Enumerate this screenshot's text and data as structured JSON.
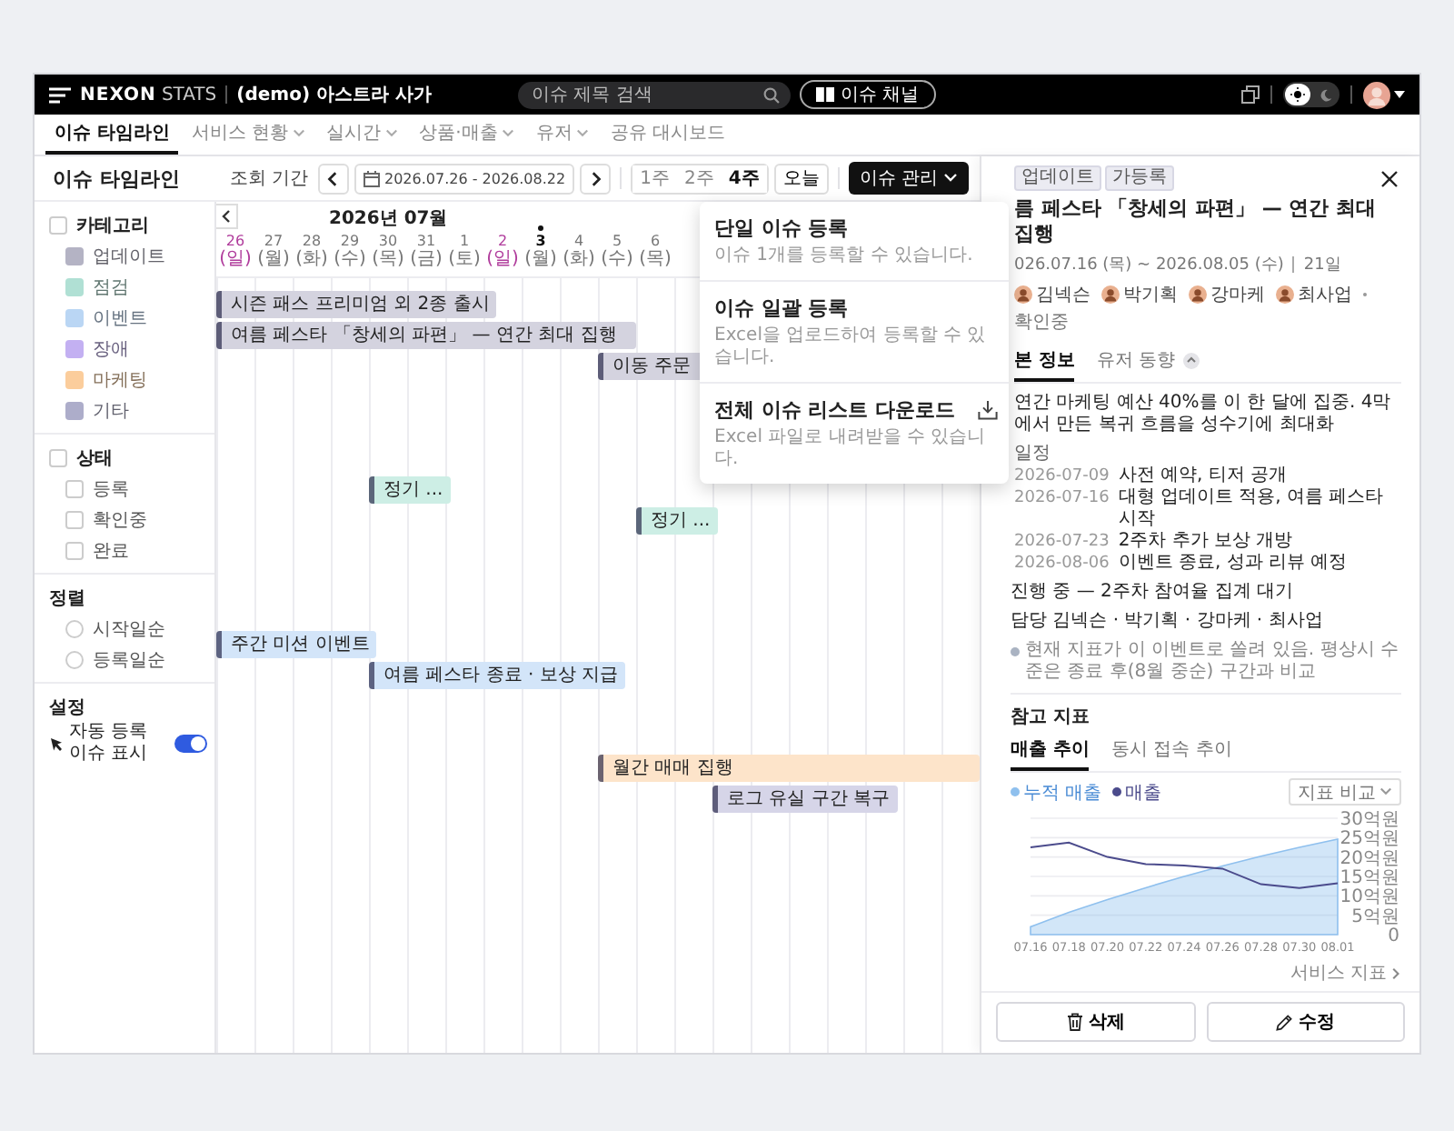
{
  "topbar": {
    "logo_bold": "NEXON",
    "logo_light": "STATS",
    "workspace": "(demo) 아스트라 사가",
    "search": {
      "placeholder": "이슈 제목 검색"
    },
    "channel_button": "이슈 채널",
    "theme": [
      {
        "kind": "light",
        "selected": true
      },
      {
        "kind": "dark",
        "selected": false
      }
    ]
  },
  "nav": [
    {
      "label": "이슈 타임라인",
      "selected": true,
      "dropdown": false
    },
    {
      "label": "서비스 현황",
      "selected": false,
      "dropdown": true
    },
    {
      "label": "실시간",
      "selected": false,
      "dropdown": true
    },
    {
      "label": "상품·매출",
      "selected": false,
      "dropdown": true
    },
    {
      "label": "유저",
      "selected": false,
      "dropdown": true
    },
    {
      "label": "공유 대시보드",
      "selected": false,
      "dropdown": false
    }
  ],
  "header": {
    "title": "이슈 타임라인",
    "period_label": "조회 기간",
    "date_range": "2026.07.26 - 2026.08.22",
    "ranges": [
      {
        "label": "1주",
        "selected": false
      },
      {
        "label": "2주",
        "selected": false
      },
      {
        "label": "4주",
        "selected": true
      }
    ],
    "today_button": "오늘",
    "manage_button": "이슈 관리"
  },
  "manage_menu": [
    {
      "title": "단일 이슈 등록",
      "description": "이슈 1개를 등록할 수 있습니다.",
      "kind": "plain"
    },
    {
      "title": "이슈 일괄 등록",
      "description": "Excel을 업로드하여 등록할 수 있습니다.",
      "kind": "plain"
    },
    {
      "title": "전체 이슈 리스트 다운로드",
      "description": "Excel 파일로 내려받을 수 있습니다.",
      "kind": "download"
    }
  ],
  "filters": {
    "category": {
      "label": "카테고리",
      "checked": false,
      "items": [
        {
          "label": "업데이트",
          "color": "#b4b3c4"
        },
        {
          "label": "점검",
          "color": "#b0e0d4"
        },
        {
          "label": "이벤트",
          "color": "#bad6f4"
        },
        {
          "label": "장애",
          "color": "#c3b0f2"
        },
        {
          "label": "마케팅",
          "color": "#fbcd9c"
        },
        {
          "label": "기타",
          "color": "#adadca"
        }
      ]
    },
    "status": {
      "label": "상태",
      "checked": false,
      "items": [
        {
          "label": "등록",
          "checked": false
        },
        {
          "label": "확인중",
          "checked": false
        },
        {
          "label": "완료",
          "checked": false
        }
      ]
    },
    "sort": {
      "label": "정렬",
      "options": [
        {
          "label": "시작일순",
          "selected": false
        },
        {
          "label": "등록일순",
          "selected": false
        }
      ]
    },
    "settings": {
      "label": "설정",
      "items": [
        {
          "label": "자동 등록 이슈 표시",
          "on": true
        }
      ]
    }
  },
  "timeline": {
    "month": "2026년 07월",
    "days": [
      {
        "day": "26",
        "weekday": "(일)",
        "kind": "sunday",
        "today": false
      },
      {
        "day": "27",
        "weekday": "(월)",
        "kind": "weekday",
        "today": false
      },
      {
        "day": "28",
        "weekday": "(화)",
        "kind": "weekday",
        "today": false
      },
      {
        "day": "29",
        "weekday": "(수)",
        "kind": "weekday",
        "today": false
      },
      {
        "day": "30",
        "weekday": "(목)",
        "kind": "weekday",
        "today": false
      },
      {
        "day": "31",
        "weekday": "(금)",
        "kind": "weekday",
        "today": false
      },
      {
        "day": "1",
        "weekday": "(토)",
        "kind": "weekday",
        "today": false
      },
      {
        "day": "2",
        "weekday": "(일)",
        "kind": "sunday",
        "today": false
      },
      {
        "day": "3",
        "weekday": "(월)",
        "kind": "weekday",
        "today": true
      },
      {
        "day": "4",
        "weekday": "(화)",
        "kind": "weekday",
        "today": false
      },
      {
        "day": "5",
        "weekday": "(수)",
        "kind": "weekday",
        "today": false
      },
      {
        "day": "6",
        "weekday": "(목)",
        "kind": "weekday",
        "today": false
      }
    ],
    "rows": [
      {
        "cells": [
          {
            "kind": "start",
            "label": "시즌 패스 프리미엄 외 2종 출시",
            "color": "#d4d3df"
          },
          {
            "kind": "continue"
          },
          {
            "kind": "continue"
          },
          {
            "kind": "continue"
          },
          {
            "kind": "continue"
          },
          {
            "kind": "continue"
          }
        ]
      },
      {
        "cells": [
          {
            "kind": "start",
            "label": "여름 페스타 「창세의 파편」 — 연간 최대 집행",
            "color": "#d4d3df"
          },
          {
            "kind": "continue"
          },
          {
            "kind": "continue"
          },
          {
            "kind": "continue"
          },
          {
            "kind": "continue"
          },
          {
            "kind": "continue"
          },
          {
            "kind": "continue"
          },
          {
            "kind": "continue"
          },
          {
            "kind": "continue"
          },
          {
            "kind": "continue"
          },
          {
            "kind": "continue"
          }
        ]
      },
      {
        "cells": [
          {
            "kind": "empty"
          },
          {
            "kind": "empty"
          },
          {
            "kind": "empty"
          },
          {
            "kind": "empty"
          },
          {
            "kind": "empty"
          },
          {
            "kind": "empty"
          },
          {
            "kind": "empty"
          },
          {
            "kind": "empty"
          },
          {
            "kind": "empty"
          },
          {
            "kind": "empty"
          },
          {
            "kind": "start",
            "label": "이동 주문",
            "color": "#d4d3df"
          },
          {
            "kind": "continue"
          },
          {
            "kind": "continue"
          },
          {
            "kind": "continue"
          }
        ]
      },
      {},
      {},
      {},
      {
        "cells": [
          {
            "kind": "empty"
          },
          {
            "kind": "empty"
          },
          {
            "kind": "empty"
          },
          {
            "kind": "empty"
          },
          {
            "kind": "start",
            "label": "정기 ...",
            "color": "#cdeee5"
          }
        ]
      },
      {
        "cells": [
          {
            "kind": "empty"
          },
          {
            "kind": "empty"
          },
          {
            "kind": "empty"
          },
          {
            "kind": "empty"
          },
          {
            "kind": "empty"
          },
          {
            "kind": "empty"
          },
          {
            "kind": "empty"
          },
          {
            "kind": "empty"
          },
          {
            "kind": "empty"
          },
          {
            "kind": "empty"
          },
          {
            "kind": "empty"
          },
          {
            "kind": "start",
            "label": "정기 ...",
            "color": "#cdeee5"
          }
        ]
      },
      {},
      {},
      {},
      {
        "cells": [
          {
            "kind": "start",
            "label": "주간 미션 이벤트",
            "color": "#d3e5f9"
          },
          {
            "kind": "continue"
          }
        ]
      },
      {
        "cells": [
          {
            "kind": "empty"
          },
          {
            "kind": "empty"
          },
          {
            "kind": "empty"
          },
          {
            "kind": "empty"
          },
          {
            "kind": "start",
            "label": "여름 페스타 종료 · 보상 지급",
            "color": "#d3e5f9"
          },
          {
            "kind": "continue"
          },
          {
            "kind": "continue"
          }
        ]
      },
      {},
      {},
      {
        "cells": [
          {
            "kind": "empty"
          },
          {
            "kind": "empty"
          },
          {
            "kind": "empty"
          },
          {
            "kind": "empty"
          },
          {
            "kind": "empty"
          },
          {
            "kind": "empty"
          },
          {
            "kind": "empty"
          },
          {
            "kind": "empty"
          },
          {
            "kind": "empty"
          },
          {
            "kind": "empty"
          },
          {
            "kind": "start",
            "label": "월간 매매 집행",
            "color": "#fde4ca"
          },
          {
            "kind": "continue"
          },
          {
            "kind": "continue"
          },
          {
            "kind": "continue"
          },
          {
            "kind": "continue"
          },
          {
            "kind": "continue"
          },
          {
            "kind": "continue"
          },
          {
            "kind": "continue"
          },
          {
            "kind": "continue"
          },
          {
            "kind": "continue"
          }
        ]
      },
      {
        "cells": [
          {
            "kind": "empty"
          },
          {
            "kind": "empty"
          },
          {
            "kind": "empty"
          },
          {
            "kind": "empty"
          },
          {
            "kind": "empty"
          },
          {
            "kind": "empty"
          },
          {
            "kind": "empty"
          },
          {
            "kind": "empty"
          },
          {
            "kind": "empty"
          },
          {
            "kind": "empty"
          },
          {
            "kind": "empty"
          },
          {
            "kind": "empty"
          },
          {
            "kind": "empty"
          },
          {
            "kind": "start",
            "label": "로그 유실 구간 복구",
            "color": "#d6d5e8"
          },
          {
            "kind": "continue"
          }
        ]
      }
    ]
  },
  "detail": {
    "tags": [
      "업데이트",
      "가등록"
    ],
    "title": "름 페스타 「창세의 파편」 — 연간 최대 집행",
    "period": "026.07.16 (목) ~ 2026.08.05 (수)",
    "duration": "21일",
    "people": [
      {
        "name": "김넥슨"
      },
      {
        "name": "박기획"
      },
      {
        "name": "강마케"
      },
      {
        "name": "최사업"
      }
    ],
    "status": "확인중",
    "tabs": [
      {
        "label": "본 정보",
        "selected": true,
        "badge": false
      },
      {
        "label": "유저 동향",
        "selected": false,
        "badge": true
      }
    ],
    "summary": "연간 마케팅 예산 40%를 이 한 달에 집중. 4막에서 만든 복귀 흐름을 성수기에 최대화",
    "schedule_label": "일정",
    "schedule": [
      {
        "date": "2026-07-09",
        "text": "사전 예약, 티저 공개"
      },
      {
        "date": "2026-07-16",
        "text": "대형 업데이트 적용, 여름 페스타 시작"
      },
      {
        "date": "2026-07-23",
        "text": "2주차 추가 보상 개방"
      },
      {
        "date": "2026-08-06",
        "text": "이벤트 종료, 성과 리뷰 예정"
      }
    ],
    "progress": "진행 중 — 2주차 참여율 집계 대기",
    "owners": "담당 김넥슨 · 박기획 · 강마케 · 최사업",
    "note": "현재 지표가 이 이벤트로 쏠려 있음. 평상시 수준은 종료 후(8월 중순) 구간과 비교",
    "metrics": {
      "title": "참고 지표",
      "tabs": [
        {
          "label": "매출 추이",
          "selected": true
        },
        {
          "label": "동시 접속 추이",
          "selected": false
        }
      ],
      "compare_button": "지표 비교",
      "chart_data": {
        "type": "area",
        "grid": true,
        "categories": [
          "07.16",
          "07.18",
          "07.20",
          "07.22",
          "07.24",
          "07.26",
          "07.28",
          "07.30",
          "08.01"
        ],
        "series": [
          {
            "name": "누적 매출",
            "color": "#8fc0ee",
            "type": "area",
            "values": [
              2,
              5.7,
              9.0,
              12.1,
              15.0,
              17.7,
              20.2,
              22.5,
              24.6
            ]
          },
          {
            "name": "매출",
            "color": "#4b4b8c",
            "type": "line",
            "values": [
              22.5,
              23.7,
              20,
              18.2,
              17.8,
              17.0,
              13,
              12,
              13.2
            ]
          }
        ],
        "ylim": [
          0,
          30
        ],
        "yticks": [
          {
            "value": 0,
            "label": "0"
          },
          {
            "value": 5,
            "label": "5억원"
          },
          {
            "value": 10,
            "label": "10억원"
          },
          {
            "value": 15,
            "label": "15억원"
          },
          {
            "value": 20,
            "label": "20억원"
          },
          {
            "value": 25,
            "label": "25억원"
          },
          {
            "value": 30,
            "label": "30억원"
          }
        ]
      },
      "link": "서비스 지표"
    },
    "actions": [
      {
        "label": "삭제",
        "kind": "delete"
      },
      {
        "label": "수정",
        "kind": "edit"
      }
    ]
  }
}
